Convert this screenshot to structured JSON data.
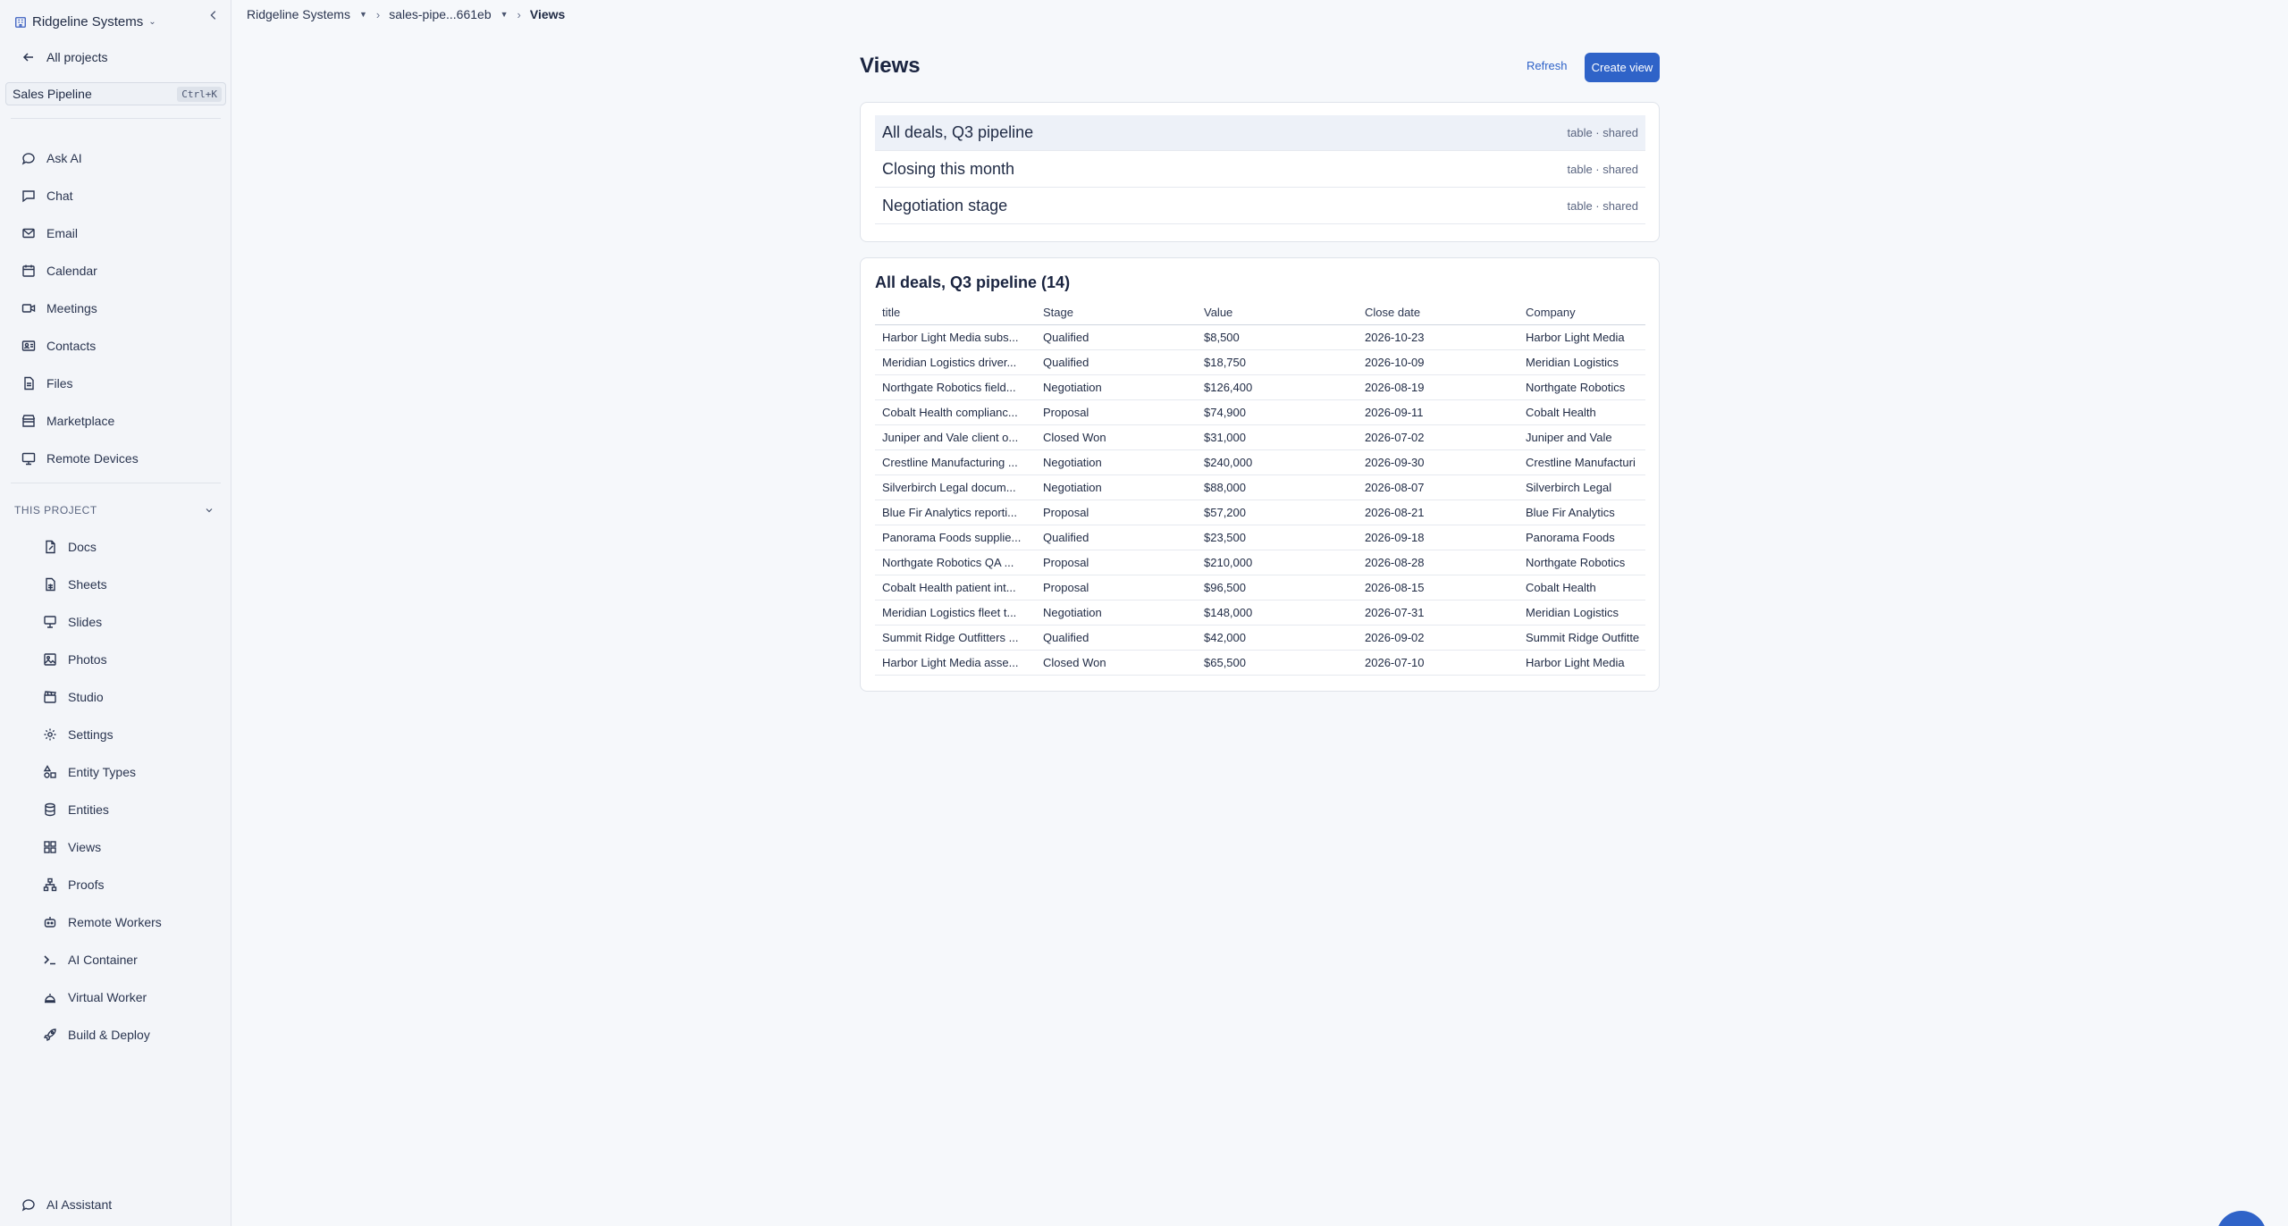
{
  "sidebar": {
    "org_name": "Ridgeline Systems",
    "back_label": "All projects",
    "project_name": "Sales Pipeline",
    "project_shortcut": "Ctrl+K",
    "nav": [
      {
        "label": "Ask AI",
        "icon": "chat-bubble-icon"
      },
      {
        "label": "Chat",
        "icon": "message-square-icon"
      },
      {
        "label": "Email",
        "icon": "mail-icon"
      },
      {
        "label": "Calendar",
        "icon": "calendar-icon"
      },
      {
        "label": "Meetings",
        "icon": "video-icon"
      },
      {
        "label": "Contacts",
        "icon": "contact-card-icon"
      },
      {
        "label": "Files",
        "icon": "files-icon"
      },
      {
        "label": "Marketplace",
        "icon": "store-icon"
      },
      {
        "label": "Remote Devices",
        "icon": "monitor-icon"
      }
    ],
    "section_label": "THIS PROJECT",
    "project_items": [
      {
        "label": "Docs",
        "icon": "doc-icon"
      },
      {
        "label": "Sheets",
        "icon": "sheet-icon"
      },
      {
        "label": "Slides",
        "icon": "presentation-icon"
      },
      {
        "label": "Photos",
        "icon": "image-icon"
      },
      {
        "label": "Studio",
        "icon": "clapperboard-icon"
      },
      {
        "label": "Settings",
        "icon": "gear-icon"
      },
      {
        "label": "Entity Types",
        "icon": "shapes-icon"
      },
      {
        "label": "Entities",
        "icon": "database-icon"
      },
      {
        "label": "Views",
        "icon": "grid-icon"
      },
      {
        "label": "Proofs",
        "icon": "hierarchy-icon"
      },
      {
        "label": "Remote Workers",
        "icon": "bot-icon"
      },
      {
        "label": "AI Container",
        "icon": "terminal-icon"
      },
      {
        "label": "Virtual Worker",
        "icon": "worker-icon"
      },
      {
        "label": "Build & Deploy",
        "icon": "rocket-icon"
      }
    ],
    "assistant_label": "AI Assistant"
  },
  "breadcrumb": {
    "org": "Ridgeline Systems",
    "project": "sales-pipe...661eb",
    "current": "Views"
  },
  "page": {
    "title": "Views",
    "refresh_label": "Refresh",
    "create_label": "Create view"
  },
  "views": [
    {
      "name": "All deals, Q3 pipeline",
      "meta": "table · shared"
    },
    {
      "name": "Closing this month",
      "meta": "table · shared"
    },
    {
      "name": "Negotiation stage",
      "meta": "table · shared"
    }
  ],
  "table": {
    "title": "All deals, Q3 pipeline (14)",
    "columns": [
      "title",
      "Stage",
      "Value",
      "Close date",
      "Company"
    ],
    "rows": [
      [
        "Harbor Light Media subs...",
        "Qualified",
        "$8,500",
        "2026-10-23",
        "Harbor Light Media"
      ],
      [
        "Meridian Logistics driver...",
        "Qualified",
        "$18,750",
        "2026-10-09",
        "Meridian Logistics"
      ],
      [
        "Northgate Robotics field...",
        "Negotiation",
        "$126,400",
        "2026-08-19",
        "Northgate Robotics"
      ],
      [
        "Cobalt Health complianc...",
        "Proposal",
        "$74,900",
        "2026-09-11",
        "Cobalt Health"
      ],
      [
        "Juniper and Vale client o...",
        "Closed Won",
        "$31,000",
        "2026-07-02",
        "Juniper and Vale"
      ],
      [
        "Crestline Manufacturing ...",
        "Negotiation",
        "$240,000",
        "2026-09-30",
        "Crestline Manufacturi"
      ],
      [
        "Silverbirch Legal docum...",
        "Negotiation",
        "$88,000",
        "2026-08-07",
        "Silverbirch Legal"
      ],
      [
        "Blue Fir Analytics reporti...",
        "Proposal",
        "$57,200",
        "2026-08-21",
        "Blue Fir Analytics"
      ],
      [
        "Panorama Foods supplie...",
        "Qualified",
        "$23,500",
        "2026-09-18",
        "Panorama Foods"
      ],
      [
        "Northgate Robotics QA ...",
        "Proposal",
        "$210,000",
        "2026-08-28",
        "Northgate Robotics"
      ],
      [
        "Cobalt Health patient int...",
        "Proposal",
        "$96,500",
        "2026-08-15",
        "Cobalt Health"
      ],
      [
        "Meridian Logistics fleet t...",
        "Negotiation",
        "$148,000",
        "2026-07-31",
        "Meridian Logistics"
      ],
      [
        "Summit Ridge Outfitters ...",
        "Qualified",
        "$42,000",
        "2026-09-02",
        "Summit Ridge Outfitte"
      ],
      [
        "Harbor Light Media asse...",
        "Closed Won",
        "$65,500",
        "2026-07-10",
        "Harbor Light Media"
      ]
    ]
  }
}
